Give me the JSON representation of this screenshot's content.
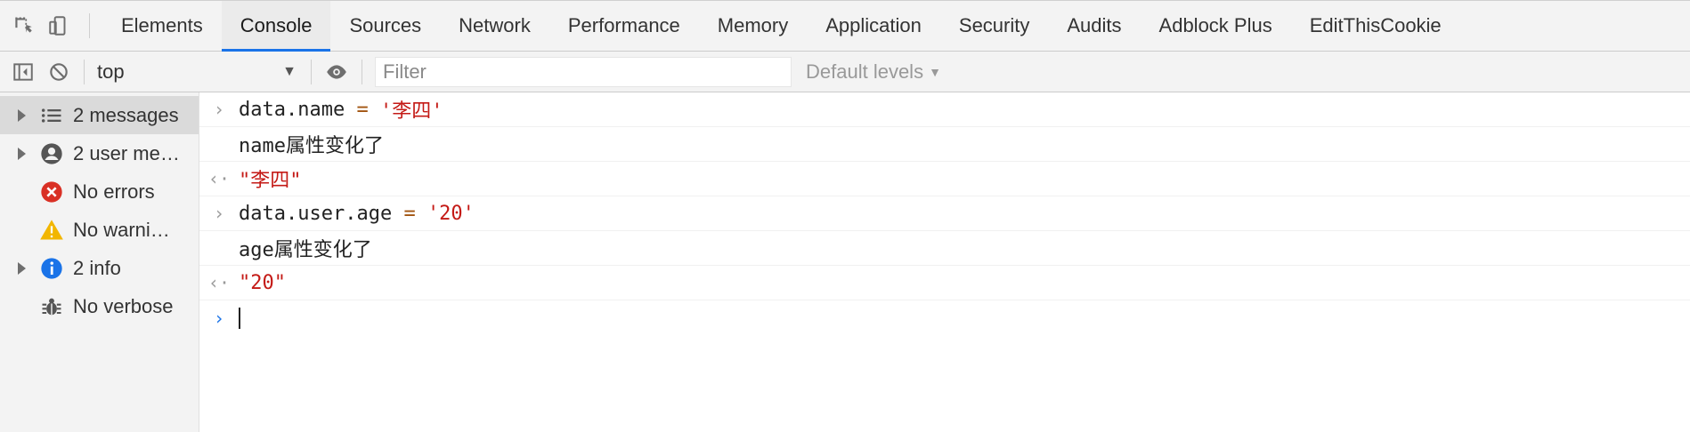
{
  "tabs": [
    {
      "label": "Elements"
    },
    {
      "label": "Console",
      "active": true
    },
    {
      "label": "Sources"
    },
    {
      "label": "Network"
    },
    {
      "label": "Performance"
    },
    {
      "label": "Memory"
    },
    {
      "label": "Application"
    },
    {
      "label": "Security"
    },
    {
      "label": "Audits"
    },
    {
      "label": "Adblock Plus"
    },
    {
      "label": "EditThisCookie"
    }
  ],
  "toolbar": {
    "context": "top",
    "filter_placeholder": "Filter",
    "levels": "Default levels"
  },
  "sidebar": {
    "items": [
      {
        "label": "2 messages",
        "icon": "list-icon"
      },
      {
        "label": "2 user me…",
        "icon": "user-icon"
      },
      {
        "label": "No errors",
        "icon": "error-icon"
      },
      {
        "label": "No warni…",
        "icon": "warning-icon"
      },
      {
        "label": "2 info",
        "icon": "info-icon"
      },
      {
        "label": "No verbose",
        "icon": "bug-icon"
      }
    ]
  },
  "console": {
    "rows": [
      {
        "kind": "input",
        "obj": "data.name",
        "op": "=",
        "val": "'李四'"
      },
      {
        "kind": "log",
        "text": "name属性变化了"
      },
      {
        "kind": "result",
        "val": "\"李四\""
      },
      {
        "kind": "input",
        "obj": "data.user.age",
        "op": "=",
        "val": "'20'"
      },
      {
        "kind": "log",
        "text": "age属性变化了"
      },
      {
        "kind": "result",
        "val": "\"20\""
      }
    ]
  },
  "colors": {
    "accent": "#1a73e8",
    "string": "#c41a16",
    "operator": "#a1540f",
    "error": "#d93025",
    "warning": "#f2b600",
    "info": "#1a73e8"
  }
}
